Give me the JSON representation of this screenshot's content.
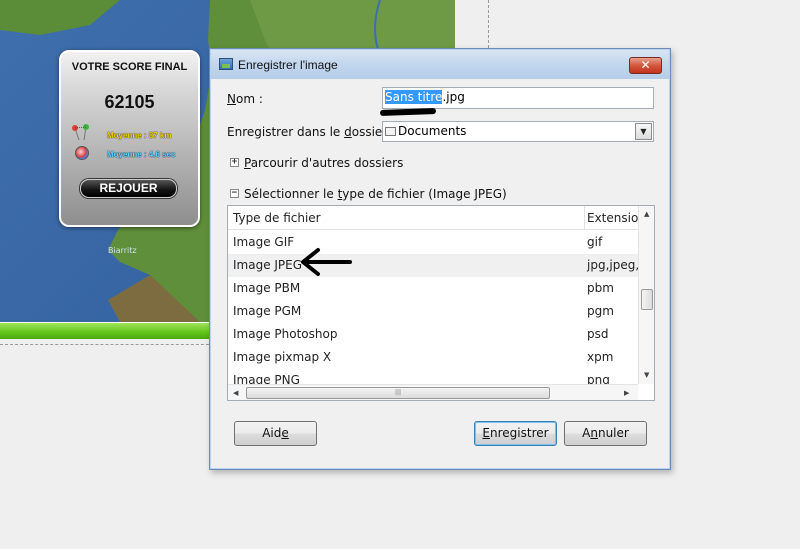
{
  "game": {
    "score_title": "VOTRE SCORE FINAL",
    "score_value": "62105",
    "avg_distance": "Moyenne : 87 km",
    "avg_time": "Moyenne : 4.6 sec",
    "replay_label": "REJOUER",
    "map_place": "Biarritz"
  },
  "dialog": {
    "title": "Enregistrer l'image",
    "close_label": "✕",
    "name_label_u": "N",
    "name_label_rest": "om :",
    "filename_selected": "Sans titre",
    "filename_rest": ".jpg",
    "folder_label_pre": "Enregistrer dans le ",
    "folder_label_u": "d",
    "folder_label_post": "ossier :",
    "folder_value": "Documents",
    "browse_expander": "+",
    "browse_label_u": "P",
    "browse_label_rest": "arcourir d'autres dossiers",
    "filetype_expander": "−",
    "filetype_label_pre": "Sélectionner le ",
    "filetype_label_u": "t",
    "filetype_label_post": "ype de fichier (Image JPEG)",
    "columns": [
      "Type de fichier",
      "Extension"
    ],
    "rows": [
      {
        "type": "Image GIF",
        "ext": "gif"
      },
      {
        "type": "Image JPEG",
        "ext": "jpg,jpeg,j"
      },
      {
        "type": "Image PBM",
        "ext": "pbm"
      },
      {
        "type": "Image PGM",
        "ext": "pgm"
      },
      {
        "type": "Image Photoshop",
        "ext": "psd"
      },
      {
        "type": "Image pixmap X",
        "ext": "xpm"
      },
      {
        "type": "Image PNG",
        "ext": "png"
      }
    ],
    "selected_row": 1,
    "scroll_up": "▲",
    "scroll_down": "▼",
    "scroll_left": "◀",
    "scroll_right": "▶",
    "help_pre": "Aid",
    "help_u": "e",
    "save_u": "E",
    "save_rest": "nregistrer",
    "cancel_pre": "A",
    "cancel_u": "n",
    "cancel_post": "nuler"
  },
  "colors": {
    "selection": "#3399ff",
    "replay_button": "#111111",
    "green_bar": "#62c418",
    "close_button": "#c2321c"
  }
}
